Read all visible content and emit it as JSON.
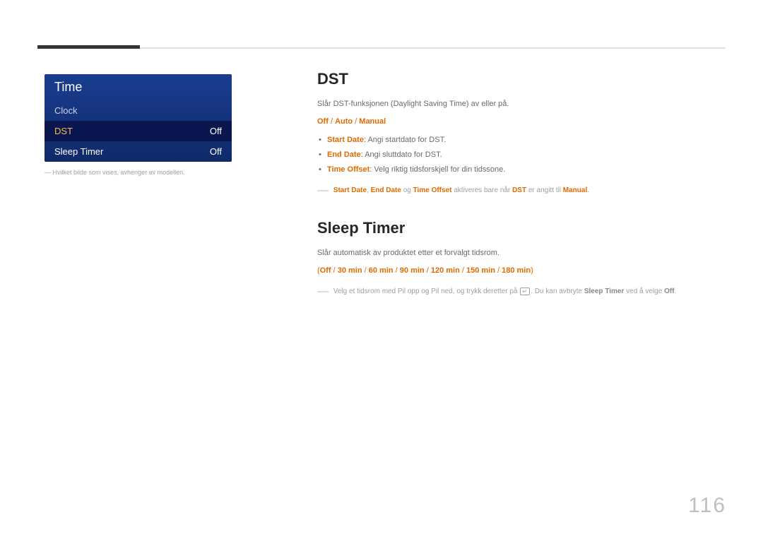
{
  "menu": {
    "title": "Time",
    "items": [
      {
        "label": "Clock",
        "value": ""
      },
      {
        "label": "DST",
        "value": "Off"
      },
      {
        "label": "Sleep Timer",
        "value": "Off"
      }
    ]
  },
  "left_footnote": "Hvilket bilde som vises, avhenger av modellen.",
  "dst": {
    "heading": "DST",
    "intro": "Slår DST-funksjonen (Daylight Saving Time) av eller på.",
    "options": {
      "a": "Off",
      "b": "Auto",
      "c": "Manual"
    },
    "bullets": [
      {
        "key": "Start Date",
        "text": ": Angi startdato for DST."
      },
      {
        "key": "End Date",
        "text": ": Angi sluttdato for DST."
      },
      {
        "key": "Time Offset",
        "text": ": Velg riktig tidsforskjell for din tidssone."
      }
    ],
    "note": {
      "k1": "Start Date",
      "k2": "End Date",
      "og": " og ",
      "k3": "Time Offset",
      "mid": " aktiveres bare når ",
      "k4": "DST",
      "mid2": " er angitt til ",
      "k5": "Manual",
      "end": "."
    }
  },
  "sleep": {
    "heading": "Sleep Timer",
    "intro": "Slår automatisk av produktet etter et forvalgt tidsrom.",
    "options": {
      "a": "Off",
      "b": "30 min",
      "c": "60 min",
      "d": "90 min",
      "e": "120 min",
      "f": "150 min",
      "g": "180 min"
    },
    "note": {
      "pre": "Velg et tidsrom med Pil opp og Pil ned, og trykk deretter på ",
      "mid": ". Du kan avbryte ",
      "k1": "Sleep Timer",
      "mid2": " ved å velge ",
      "k2": "Off",
      "end": "."
    }
  },
  "page_number": "116"
}
